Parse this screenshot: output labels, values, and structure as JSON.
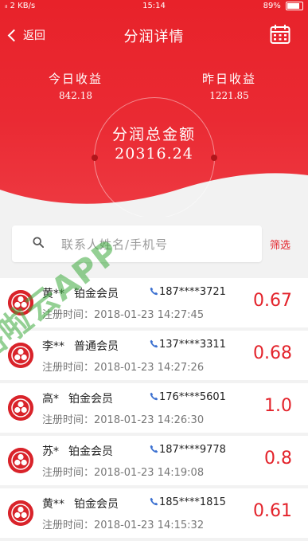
{
  "status_bar": {
    "left": "ᵢₗ 2 KB/s",
    "time": "15:14",
    "battery": "89%",
    "battery_level": 0.89
  },
  "nav": {
    "back_label": "返回",
    "title": "分润详情",
    "calendar_icon": "calendar-icon"
  },
  "summary": {
    "today_label": "今日收益",
    "today_value": "842.18",
    "yesterday_label": "昨日收益",
    "yesterday_value": "1221.85",
    "total_label": "分润总金额",
    "total_value": "20316.24"
  },
  "search": {
    "placeholder": "联系人姓名/手机号",
    "value": "",
    "filter_label": "筛选"
  },
  "list": [
    {
      "name": "黄**",
      "level": "铂金会员",
      "phone": "187****3721",
      "reg_label": "注册时间：",
      "reg_time": "2018-01-23 14:27:45",
      "ratio": "0.67"
    },
    {
      "name": "李**",
      "level": "普通会员",
      "phone": "137****3311",
      "reg_label": "注册时间：",
      "reg_time": "2018-01-23 14:27:26",
      "ratio": "0.68"
    },
    {
      "name": "高*",
      "level": "铂金会员",
      "phone": "176****5601",
      "reg_label": "注册时间：",
      "reg_time": "2018-01-23 14:26:30",
      "ratio": "1.0"
    },
    {
      "name": "苏*",
      "level": "铂金会员",
      "phone": "187****9778",
      "reg_label": "注册时间：",
      "reg_time": "2018-01-23 14:19:08",
      "ratio": "0.8"
    },
    {
      "name": "黄**",
      "level": "铂金会员",
      "phone": "185****1815",
      "reg_label": "注册时间：",
      "reg_time": "2018-01-23 14:15:32",
      "ratio": "0.61"
    }
  ],
  "watermark": "杉德略啦云APP",
  "colors": {
    "brand_red": "#e8222a",
    "accent_red": "#e3232b",
    "watermark_green": "#3caa3c"
  }
}
